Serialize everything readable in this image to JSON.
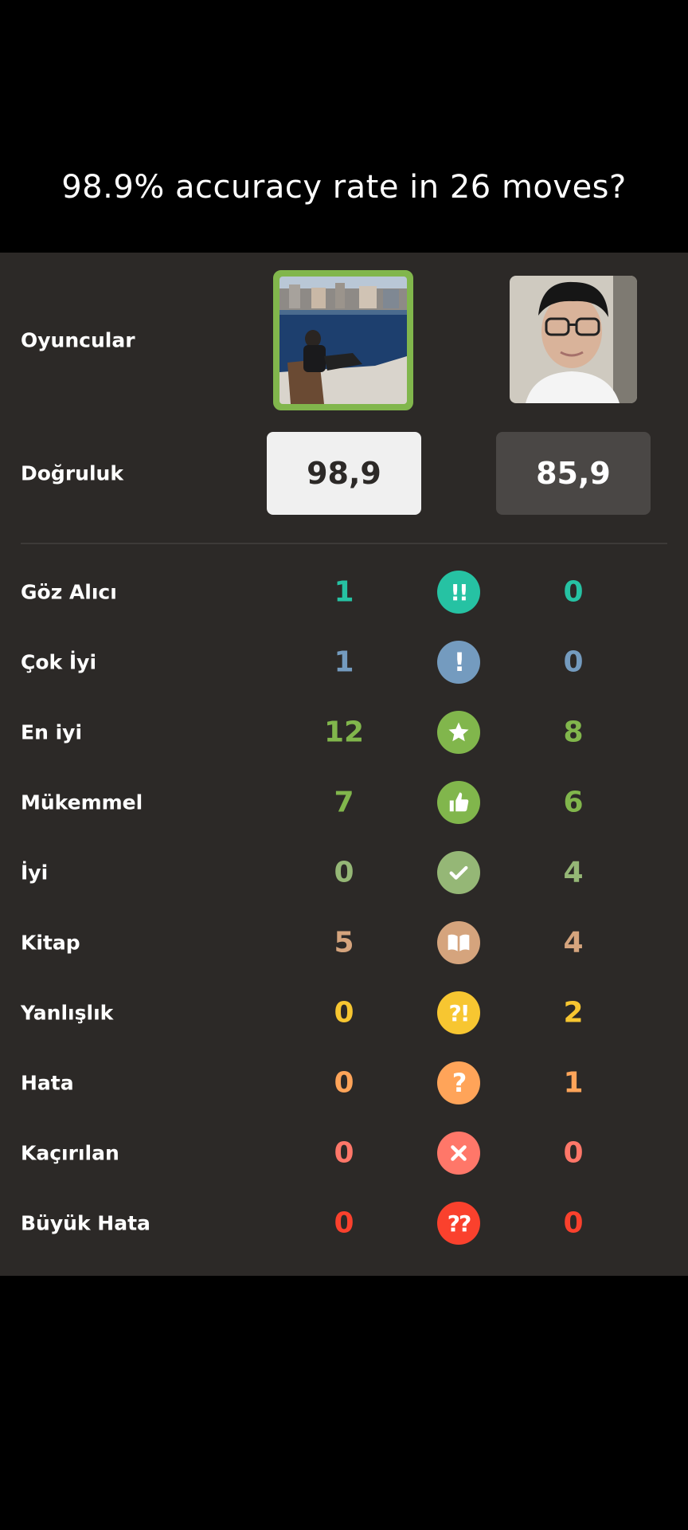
{
  "caption": "98.9% accuracy rate in 26 moves?",
  "labels": {
    "players": "Oyuncular",
    "accuracy": "Doğruluk"
  },
  "accuracy": {
    "player1": "98,9",
    "player2": "85,9"
  },
  "stats": [
    {
      "label": "Göz Alıcı",
      "p1": "1",
      "p2": "0",
      "color": "#26c2a3",
      "icon": "brilliant-icon",
      "symbol": "!!"
    },
    {
      "label": "Çok İyi",
      "p1": "1",
      "p2": "0",
      "color": "#749bbf",
      "icon": "great-icon",
      "symbol": "!"
    },
    {
      "label": "En iyi",
      "p1": "12",
      "p2": "8",
      "color": "#81b64c",
      "icon": "best-star-icon",
      "symbol": ""
    },
    {
      "label": "Mükemmel",
      "p1": "7",
      "p2": "6",
      "color": "#81b64c",
      "icon": "excellent-thumb-icon",
      "symbol": ""
    },
    {
      "label": "İyi",
      "p1": "0",
      "p2": "4",
      "color": "#95b776",
      "icon": "good-check-icon",
      "symbol": ""
    },
    {
      "label": "Kitap",
      "p1": "5",
      "p2": "4",
      "color": "#d5a47d",
      "icon": "book-icon",
      "symbol": ""
    },
    {
      "label": "Yanlışlık",
      "p1": "0",
      "p2": "2",
      "color": "#f7c631",
      "icon": "inaccuracy-icon",
      "symbol": "?!"
    },
    {
      "label": "Hata",
      "p1": "0",
      "p2": "1",
      "color": "#ffa459",
      "icon": "mistake-icon",
      "symbol": "?"
    },
    {
      "label": "Kaçırılan",
      "p1": "0",
      "p2": "0",
      "color": "#ff7769",
      "icon": "miss-x-icon",
      "symbol": ""
    },
    {
      "label": "Büyük Hata",
      "p1": "0",
      "p2": "0",
      "color": "#fa412d",
      "icon": "blunder-icon",
      "symbol": "??"
    }
  ]
}
